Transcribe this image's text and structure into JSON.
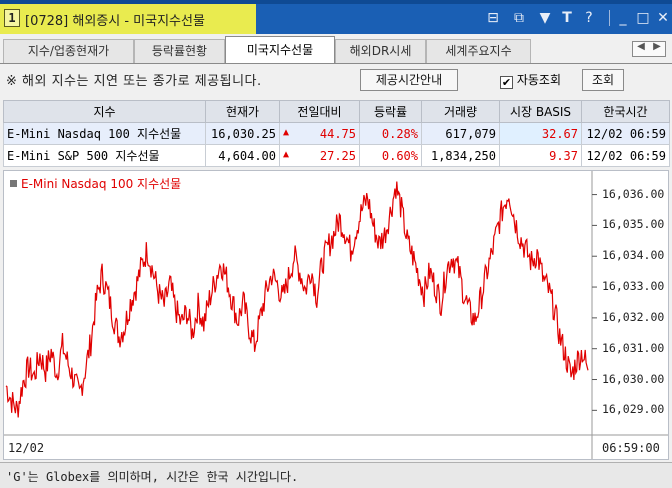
{
  "window": {
    "screen_number": "1",
    "title": "[0728] 해외증시 - 미국지수선물",
    "controls": [
      "restore-layout",
      "new-window",
      "pin",
      "font-size",
      "help",
      "minimize",
      "maximize",
      "close"
    ]
  },
  "tabs": [
    {
      "label": "지수/업종현재가",
      "active": false
    },
    {
      "label": "등락률현황",
      "active": false
    },
    {
      "label": "미국지수선물",
      "active": true
    },
    {
      "label": "해외DR시세",
      "active": false
    },
    {
      "label": "세계주요지수",
      "active": false
    }
  ],
  "toolbar": {
    "notice": "※ 해외 지수는 지연 또는 종가로 제공됩니다.",
    "info_button": "제공시간안내",
    "auto_query_label": "자동조회",
    "auto_query_checked": true,
    "query_button": "조회"
  },
  "table": {
    "columns": [
      "지수",
      "현재가",
      "전일대비",
      "등락률",
      "거래량",
      "시장 BASIS",
      "한국시간"
    ],
    "rows": [
      {
        "name": "E-Mini Nasdaq 100 지수선물",
        "price": "16,030.25",
        "change": "44.75",
        "rate": "0.28%",
        "volume": "617,079",
        "basis": "32.67",
        "time": "12/02 06:59"
      },
      {
        "name": "E-Mini S&P 500 지수선물",
        "price": "4,604.00",
        "change": "27.25",
        "rate": "0.60%",
        "volume": "1,834,250",
        "basis": "9.37",
        "time": "12/02 06:59"
      }
    ]
  },
  "colors": {
    "up": "#e00000",
    "accent": "#1a5fb4",
    "title_highlight": "#e9eb4f"
  },
  "chart_data": {
    "type": "line",
    "title": "E-Mini Nasdaq 100 지수선물",
    "x_start_label": "12/02",
    "x_end_label": "06:59:00",
    "yticks": [
      "16,036.00",
      "16,035.00",
      "16,034.00",
      "16,033.00",
      "16,032.00",
      "16,031.00",
      "16,030.00",
      "16,029.00"
    ],
    "ylim": [
      16028.2,
      16036.7
    ],
    "grid": false,
    "series": [
      {
        "color": "#e00000",
        "values": [
          16029.8,
          16029.3,
          16029.0,
          16029.9,
          16030.4,
          16030.1,
          16030.8,
          16030.3,
          16030.9,
          16030.2,
          16031.1,
          16030.5,
          16030.0,
          16029.5,
          16030.3,
          16031.2,
          16032.6,
          16033.4,
          16032.8,
          16032.0,
          16031.4,
          16031.7,
          16032.5,
          16033.0,
          16033.7,
          16034.2,
          16033.5,
          16032.8,
          16032.4,
          16033.1,
          16032.3,
          16031.8,
          16032.2,
          16031.5,
          16032.4,
          16031.8,
          16032.6,
          16033.2,
          16033.8,
          16033.3,
          16032.6,
          16031.9,
          16032.5,
          16031.7,
          16031.1,
          16032.0,
          16032.8,
          16033.4,
          16033.1,
          16032.6,
          16033.3,
          16034.0,
          16033.5,
          16032.9,
          16033.6,
          16032.7,
          16033.8,
          16034.3,
          16034.7,
          16035.2,
          16034.8,
          16034.2,
          16034.9,
          16035.5,
          16035.9,
          16035.0,
          16034.4,
          16034.7,
          16035.4,
          16036.3,
          16035.5,
          16034.5,
          16034.0,
          16033.4,
          16032.8,
          16033.5,
          16033.0,
          16032.5,
          16033.6,
          16034.0,
          16033.6,
          16032.8,
          16032.2,
          16031.9,
          16032.6,
          16033.4,
          16034.1,
          16034.9,
          16035.6,
          16036.1,
          16035.2,
          16034.6,
          16034.2,
          16033.8,
          16034.1,
          16033.3,
          16032.9,
          16032.3,
          16031.4,
          16030.8,
          16030.1,
          16030.6,
          16030.9,
          16030.3
        ]
      }
    ]
  },
  "footer": {
    "note": "'G'는 Globex를 의미하며, 시간은 한국 시간입니다."
  }
}
